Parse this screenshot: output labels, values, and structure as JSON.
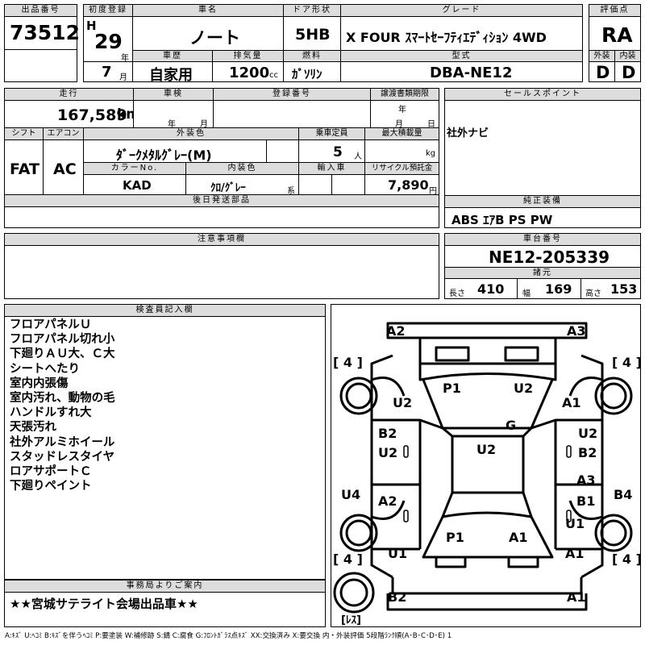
{
  "headers": {
    "lot_no": "出品番号",
    "first_reg": "初度登録",
    "car_name": "車名",
    "door": "ドア形状",
    "grade": "グレード",
    "score": "評価点",
    "history": "車歴",
    "displacement": "排気量",
    "fuel": "燃料",
    "model": "型式",
    "exterior": "外装",
    "interior": "内装",
    "mileage": "走行",
    "inspection": "車検",
    "plate": "登録番号",
    "transfer": "譲渡書類期限",
    "sales_point": "セールスポイント",
    "shift": "シフト",
    "aircon": "エアコン",
    "ext_color": "外装色",
    "capacity": "乗車定員",
    "max_load": "最大積載量",
    "color_no": "カラーNo.",
    "int_color": "内装色",
    "import": "輸入車",
    "recycle": "リサイクル預託金",
    "later_parts": "後日発送部品",
    "genuine": "純正装備",
    "caution": "注意事項欄",
    "chassis": "車台番号",
    "specs": "諸元",
    "inspector": "検査員記入欄",
    "office": "事務局よりご案内"
  },
  "lot_no": "73512",
  "era": "H",
  "year": "29",
  "month": "7",
  "u_nen": "年",
  "u_tsuki": "月",
  "car_name": "ノート",
  "door": "5HB",
  "grade": "X FOUR ｽﾏｰﾄｾｰﾌﾃｨｴﾃﾞｨｼｮﾝ 4WD",
  "score": "RA",
  "history": "自家用",
  "displacement": "1200",
  "cc": "cc",
  "fuel": "ｶﾞｿﾘﾝ",
  "model": "DBA-NE12",
  "exterior_grade": "D",
  "interior_grade": "D",
  "mileage": "167,589",
  "km": "km",
  "ins_nen": "年",
  "ins_tsuki": "月",
  "tr_nen": "年",
  "tr_tsuki": "月",
  "tr_nichi": "日",
  "sales_point": "社外ナビ",
  "shift": "FAT",
  "aircon": "AC",
  "ext_color": "ﾀﾞｰｸﾒﾀﾙｸﾞﾚｰ(M)",
  "capacity": "5",
  "capacity_unit": "人",
  "kg": "kg",
  "color_no": "KAD",
  "int_color": "ｸﾛ/ｸﾞﾚｰ",
  "kei": "系",
  "recycle": "7,890",
  "yen": "円",
  "genuine": "ABS ｴｱB PS PW",
  "chassis": "NE12-205339",
  "length_label": "長さ",
  "length": "410",
  "width_label": "幅",
  "width": "169",
  "height_label": "高さ",
  "height": "153",
  "notes": [
    "フロアパネルＵ",
    "フロアパネル切れ小",
    "下廻りＡＵ大、Ｃ大",
    "シートへたり",
    "室内内張傷",
    "室内汚れ、動物の毛",
    "ハンドルすれ大",
    "天張汚れ",
    "社外アルミホイール",
    "スタッドレスタイヤ",
    "ロアサポートＣ",
    "下廻りペイント"
  ],
  "office": "★★宮城サテライト会場出品車★★",
  "diagram": {
    "front_left": "A2",
    "front_right": "A3",
    "tire_fl": "[ 4 ]",
    "tire_fr": "[ 4 ]",
    "tire_rl": "[ 4 ]",
    "tire_rr": "[ 4 ]",
    "hood_left": "P1",
    "hood_right": "U2",
    "fender_left": "U2",
    "fender_right": "A1",
    "windshield": "G",
    "door_fl": "B2",
    "door_fl2": "U2",
    "door_fr": "U2",
    "door_fr2": "B2",
    "roof": "U2",
    "sill_left": "U4",
    "door_rl": "A2",
    "door_rr_a": "A3",
    "door_rr_b": "B1",
    "sill_right": "B4",
    "qtr_right": "U1",
    "trunk_left": "P1",
    "trunk_right": "A1",
    "qtr_left": "U1",
    "rear_qtr_right": "A1",
    "rear_left": "B2",
    "rear_right": "A1",
    "spare": "[ﾚｽ]"
  },
  "legend": "A:ｷｽﾞ U:ﾍｺﾐ B:ｷｽﾞを伴うﾍｺﾐ P:要塗装 W:補修跡 S:錆 C:腐食 G:ﾌﾛﾝﾄｶﾞﾗｽ点ｷｽﾞ XX:交換済み X:要交換 内・外装評価 5段階ﾗﾝｸ順(A･B･C･D･E) 1"
}
